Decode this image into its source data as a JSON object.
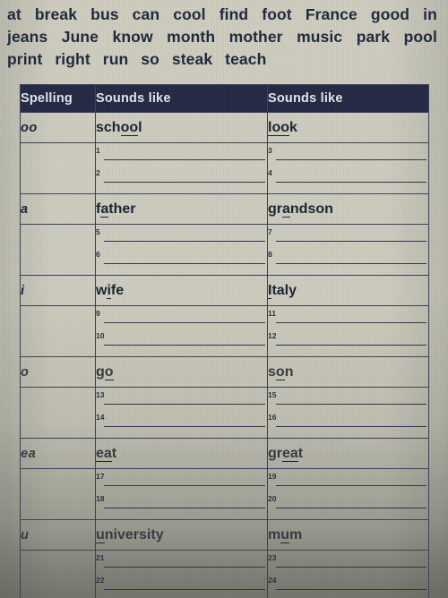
{
  "word_bank": {
    "lines": [
      [
        "at",
        "break",
        "bus",
        "can",
        "cool",
        "find",
        "foot",
        "France",
        "good",
        "in"
      ],
      [
        "jeans",
        "June",
        "know",
        "month",
        "mother",
        "music",
        "park",
        "pool"
      ],
      [
        "print",
        "right",
        "run",
        "so",
        "steak",
        "teach"
      ]
    ]
  },
  "table": {
    "headers": [
      "Spelling",
      "Sounds like",
      "Sounds like"
    ],
    "rows": [
      {
        "spelling": "oo",
        "example_mid_pre": "sch",
        "example_mid_u": "oo",
        "example_mid_post": "l",
        "example_right_pre": "",
        "example_right_u": "loo",
        "example_right_post": "k",
        "numbers_mid": [
          "1",
          "2"
        ],
        "numbers_right": [
          "3",
          "4"
        ]
      },
      {
        "spelling": "a",
        "example_mid_pre": "f",
        "example_mid_u": "a",
        "example_mid_post": "ther",
        "example_right_pre": "gr",
        "example_right_u": "a",
        "example_right_post": "ndson",
        "numbers_mid": [
          "5",
          "6"
        ],
        "numbers_right": [
          "7",
          "8"
        ]
      },
      {
        "spelling": "i",
        "example_mid_pre": "w",
        "example_mid_u": "i",
        "example_mid_post": "fe",
        "example_right_pre": "",
        "example_right_u": "I",
        "example_right_post": "taly",
        "numbers_mid": [
          "9",
          "10"
        ],
        "numbers_right": [
          "11",
          "12"
        ]
      },
      {
        "spelling": "o",
        "example_mid_pre": "g",
        "example_mid_u": "o",
        "example_mid_post": "",
        "example_right_pre": "s",
        "example_right_u": "o",
        "example_right_post": "n",
        "numbers_mid": [
          "13",
          "14"
        ],
        "numbers_right": [
          "15",
          "16"
        ]
      },
      {
        "spelling": "ea",
        "example_mid_pre": "",
        "example_mid_u": "ea",
        "example_mid_post": "t",
        "example_right_pre": "gr",
        "example_right_u": "ea",
        "example_right_post": "t",
        "numbers_mid": [
          "17",
          "18"
        ],
        "numbers_right": [
          "19",
          "20"
        ]
      },
      {
        "spelling": "u",
        "example_mid_pre": "",
        "example_mid_u": "u",
        "example_mid_post": "niversity",
        "example_right_pre": "m",
        "example_right_u": "u",
        "example_right_post": "m",
        "numbers_mid": [
          "21",
          "22"
        ],
        "numbers_right": [
          "23",
          "24"
        ]
      }
    ]
  },
  "colors": {
    "header_bg": "#272c47",
    "header_text": "#e9eaf1",
    "paper": "#cfcec0",
    "ink": "#1d2436",
    "rule": "#3c445c"
  }
}
